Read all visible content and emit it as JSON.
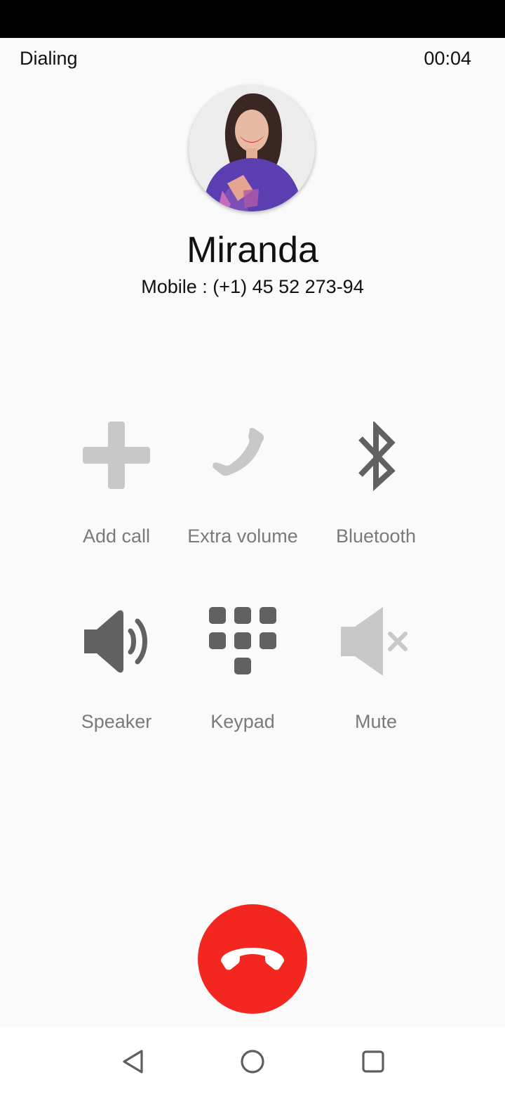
{
  "call": {
    "status": "Dialing",
    "timer": "00:04"
  },
  "contact": {
    "name": "Miranda",
    "number": "Mobile : (+1) 45 52 273-94"
  },
  "actions": {
    "add_call": {
      "label": "Add call",
      "icon": "plus-icon",
      "enabled": false
    },
    "extra_volume": {
      "label": "Extra volume",
      "icon": "phone-icon",
      "enabled": false
    },
    "bluetooth": {
      "label": "Bluetooth",
      "icon": "bluetooth-icon",
      "enabled": true
    },
    "speaker": {
      "label": "Speaker",
      "icon": "speaker-icon",
      "enabled": true
    },
    "keypad": {
      "label": "Keypad",
      "icon": "keypad-icon",
      "enabled": true
    },
    "mute": {
      "label": "Mute",
      "icon": "mute-icon",
      "enabled": false
    }
  },
  "end_call": {
    "icon": "hang-up-icon",
    "color": "#f3271f"
  },
  "colors": {
    "enabled_icon": "#616161",
    "disabled_icon": "#c8c8c8",
    "label": "#7a7a7a"
  },
  "navigation": {
    "back": "back-triangle-icon",
    "home": "home-circle-icon",
    "recents": "recents-square-icon"
  }
}
